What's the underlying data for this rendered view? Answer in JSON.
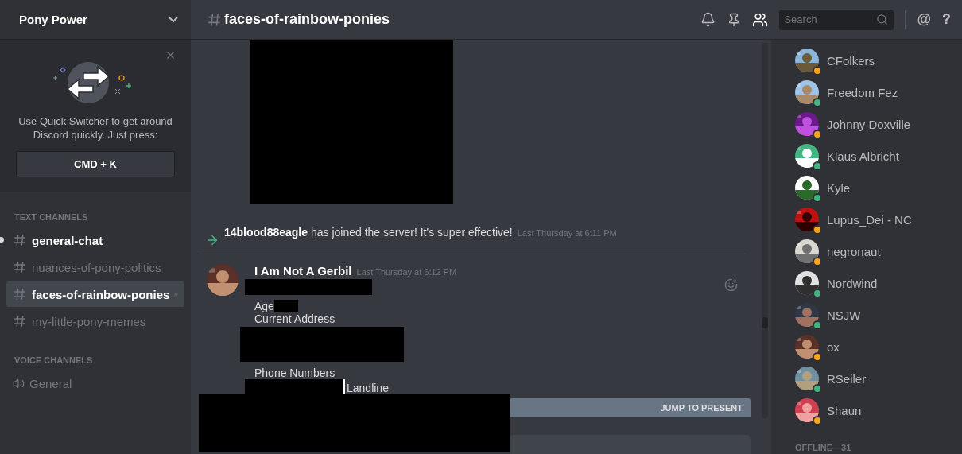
{
  "server": {
    "name": "Pony Power"
  },
  "quick_switcher": {
    "text": "Use Quick Switcher to get around Discord quickly. Just press:",
    "shortcut": "CMD + K"
  },
  "text_channels": {
    "heading": "TEXT CHANNELS",
    "items": [
      {
        "name": "general-chat",
        "selected": false,
        "unread": true
      },
      {
        "name": "nuances-of-pony-politics",
        "selected": false,
        "unread": false
      },
      {
        "name": "faces-of-rainbow-ponies",
        "selected": true,
        "unread": false
      },
      {
        "name": "my-little-pony-memes",
        "selected": false,
        "unread": false
      }
    ]
  },
  "voice_channels": {
    "heading": "VOICE CHANNELS",
    "items": [
      {
        "name": "General"
      }
    ]
  },
  "channel_header": {
    "name": "faces-of-rainbow-ponies",
    "search_placeholder": "Search",
    "mention_glyph": "@",
    "help_glyph": "?"
  },
  "join_message": {
    "text": "**14blood88eagle** has joined the server! It's super effective!",
    "time": "Last Thursday at 6:11 PM"
  },
  "message": {
    "author": "I Am Not A Gerbil",
    "time": "Last Thursday at 6:12 PM",
    "lines": [
      {
        "kind": "redacted"
      },
      {
        "kind": "text_then_redacted",
        "text": "Age"
      },
      {
        "kind": "text",
        "text": "Current Address"
      },
      {
        "kind": "redacted"
      },
      {
        "kind": "text",
        "text": "Phone Numbers"
      },
      {
        "kind": "redacted_then_text",
        "text": "Landline"
      }
    ]
  },
  "jump_bar": {
    "label": "JUMP TO PRESENT"
  },
  "members": [
    {
      "name": "CFolkers",
      "color": "#faa61a"
    },
    {
      "name": "Freedom Fez",
      "color": "#43b581"
    },
    {
      "name": "Johnny Doxville",
      "color": "#faa61a"
    },
    {
      "name": "Klaus Albricht",
      "color": "#43b581"
    },
    {
      "name": "Kyle",
      "color": "#43b581"
    },
    {
      "name": "Lupus_Dei - NC",
      "color": "#faa61a"
    },
    {
      "name": "negronaut",
      "color": "#faa61a"
    },
    {
      "name": "Nordwind",
      "color": "#43b581"
    },
    {
      "name": "NSJW",
      "color": "#43b581"
    },
    {
      "name": "ox",
      "color": "#faa61a"
    },
    {
      "name": "RSeiler",
      "color": "#43b581"
    },
    {
      "name": "Shaun",
      "color": "#faa61a"
    }
  ],
  "offline_heading": "OFFLINE—31"
}
